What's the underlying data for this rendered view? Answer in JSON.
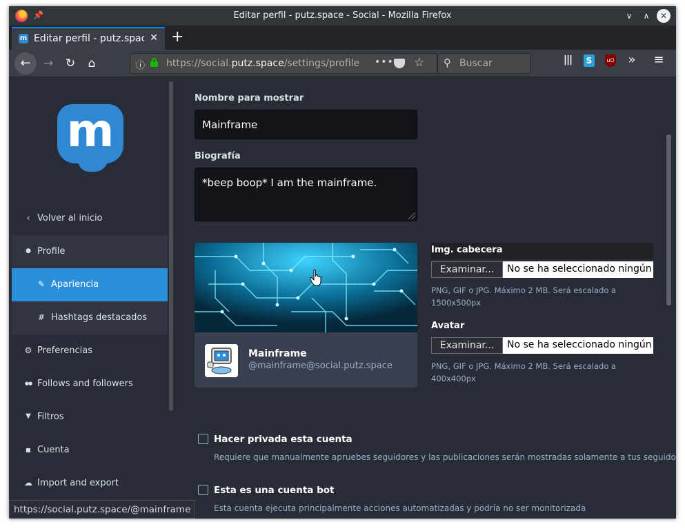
{
  "window": {
    "title": "Editar perfil - putz.space - Social - Mozilla Firefox",
    "minimize_glyph": "∨",
    "maximize_glyph": "∧",
    "close_glyph": "✕"
  },
  "tab": {
    "label": "Editar perfil - putz.space",
    "favicon": "m",
    "close_glyph": "✕",
    "new_tab_glyph": "+"
  },
  "navbar": {
    "back_glyph": "←",
    "forward_glyph": "→",
    "reload_glyph": "↻",
    "home_glyph": "⌂",
    "url_prefix": "https://social.",
    "url_host": "putz.space",
    "url_path": "/settings/profile",
    "url_more": "•••",
    "star_glyph": "☆",
    "search_placeholder": "Buscar",
    "search_glyph": "⚲",
    "menu_glyph": "≡",
    "overflow_glyph": "»",
    "library_glyph": "|||",
    "ext1_glyph": "S",
    "ext2_glyph": "uO"
  },
  "sidebar": {
    "items": [
      {
        "icon": "‹",
        "label": "Volver al inicio"
      },
      {
        "icon": "●",
        "label": "Profile"
      },
      {
        "icon": "✎",
        "label": "Apariencia"
      },
      {
        "icon": "#",
        "label": "Hashtags destacados"
      },
      {
        "icon": "⚙",
        "label": "Preferencias"
      },
      {
        "icon": "●●",
        "label": "Follows and followers"
      },
      {
        "icon": "▼",
        "label": "Filtros"
      },
      {
        "icon": "▪",
        "label": "Cuenta"
      },
      {
        "icon": "☁",
        "label": "Import and export"
      }
    ]
  },
  "form": {
    "display_name_label": "Nombre para mostrar",
    "display_name_value": "Mainframe",
    "bio_label": "Biografía",
    "bio_value": "*beep boop* I am the mainframe.",
    "header_label": "Img. cabecera",
    "avatar_label": "Avatar",
    "browse_label": "Examinar...",
    "no_file": "No se ha seleccionado ningún archivo.",
    "header_hint": "PNG, GIF o JPG. Máximo 2 MB. Será escalado a 1500x500px",
    "avatar_hint": "PNG, GIF o JPG. Máximo 2 MB. Será escalado a 400x400px",
    "private_label": "Hacer privada esta cuenta",
    "private_hint": "Requiere que manualmente apruebes seguidores y las publicaciones serán mostradas solamente a tus seguidores",
    "bot_label": "Esta es una cuenta bot",
    "bot_hint": "Esta cuenta ejecuta principalmente acciones automatizadas y podría no ser monitorizada"
  },
  "preview": {
    "display_name": "Mainframe",
    "account": "@mainframe@social.putz.space"
  },
  "status_url": "https://social.putz.space/@mainframe",
  "colors": {
    "accent": "#2b90d9",
    "sidebar": "#282c37",
    "group": "#313543",
    "brand": "#3088d4"
  }
}
